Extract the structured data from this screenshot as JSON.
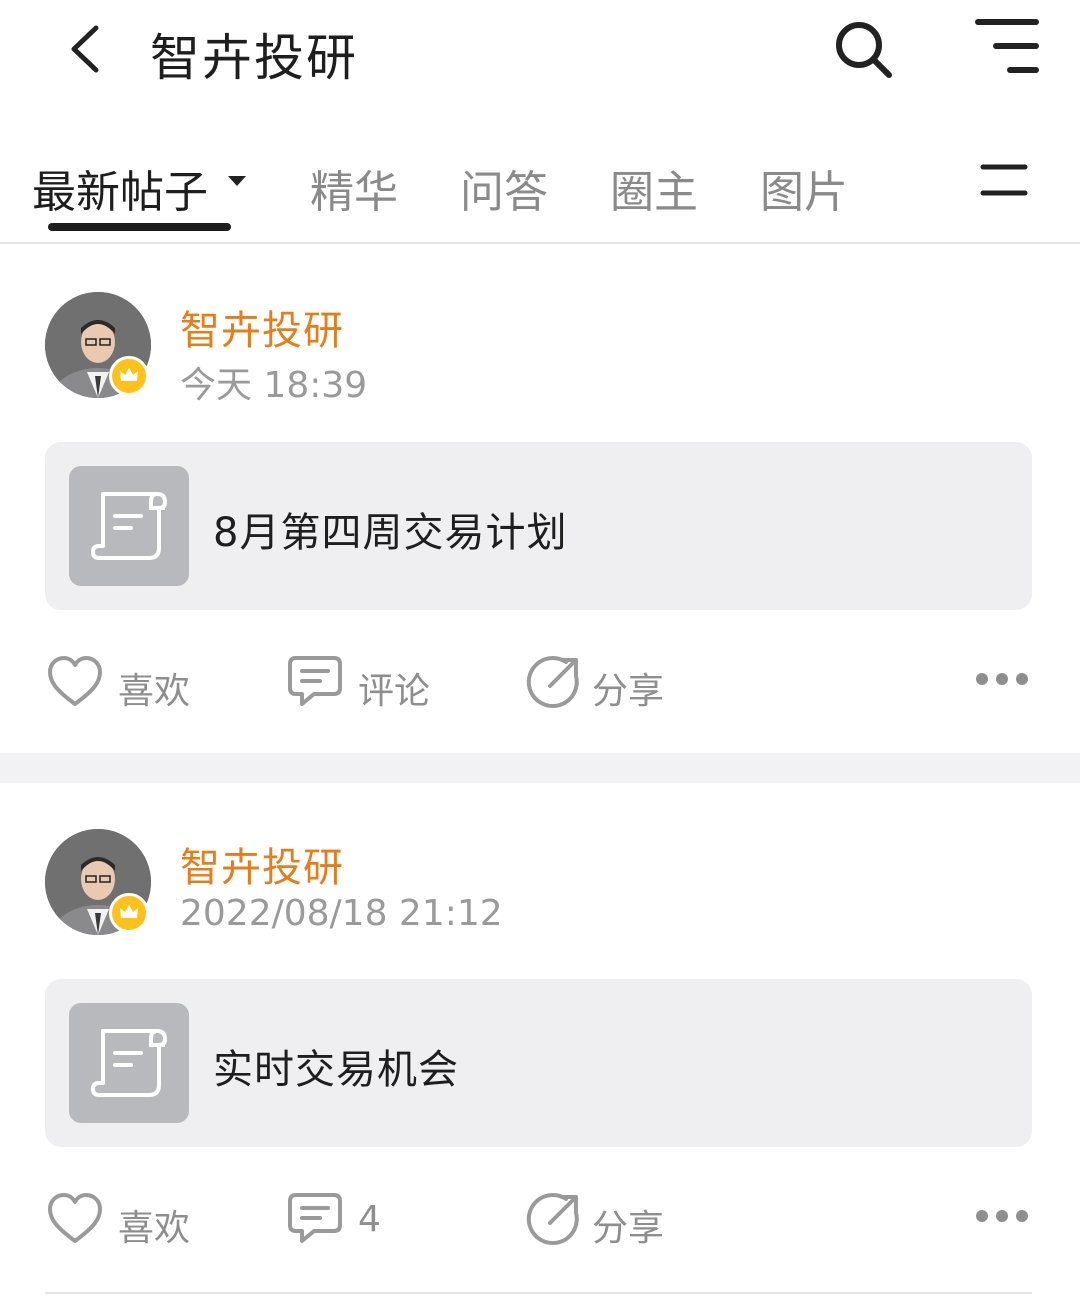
{
  "header": {
    "title": "智卉投研"
  },
  "tabs": [
    {
      "label": "最新帖子"
    },
    {
      "label": "精华"
    },
    {
      "label": "问答"
    },
    {
      "label": "圈主"
    },
    {
      "label": "图片"
    }
  ],
  "posts": [
    {
      "author": "智卉投研",
      "time": "今天 18:39",
      "title": "8月第四周交易计划",
      "like_label": "喜欢",
      "comment_label": "评论",
      "share_label": "分享"
    },
    {
      "author": "智卉投研",
      "time": "2022/08/18 21:12",
      "title": "实时交易机会",
      "like_label": "喜欢",
      "comment_label": "4",
      "share_label": "分享"
    }
  ],
  "colors": {
    "author": "#e57e1a",
    "badge": "#ffc21a",
    "card_bg": "#efeff1"
  },
  "icons": [
    "back-icon",
    "search-icon",
    "menu-icon",
    "dropdown-caret-icon",
    "list-menu-icon",
    "crown-icon",
    "document-icon",
    "heart-icon",
    "comment-icon",
    "share-icon",
    "more-icon"
  ]
}
